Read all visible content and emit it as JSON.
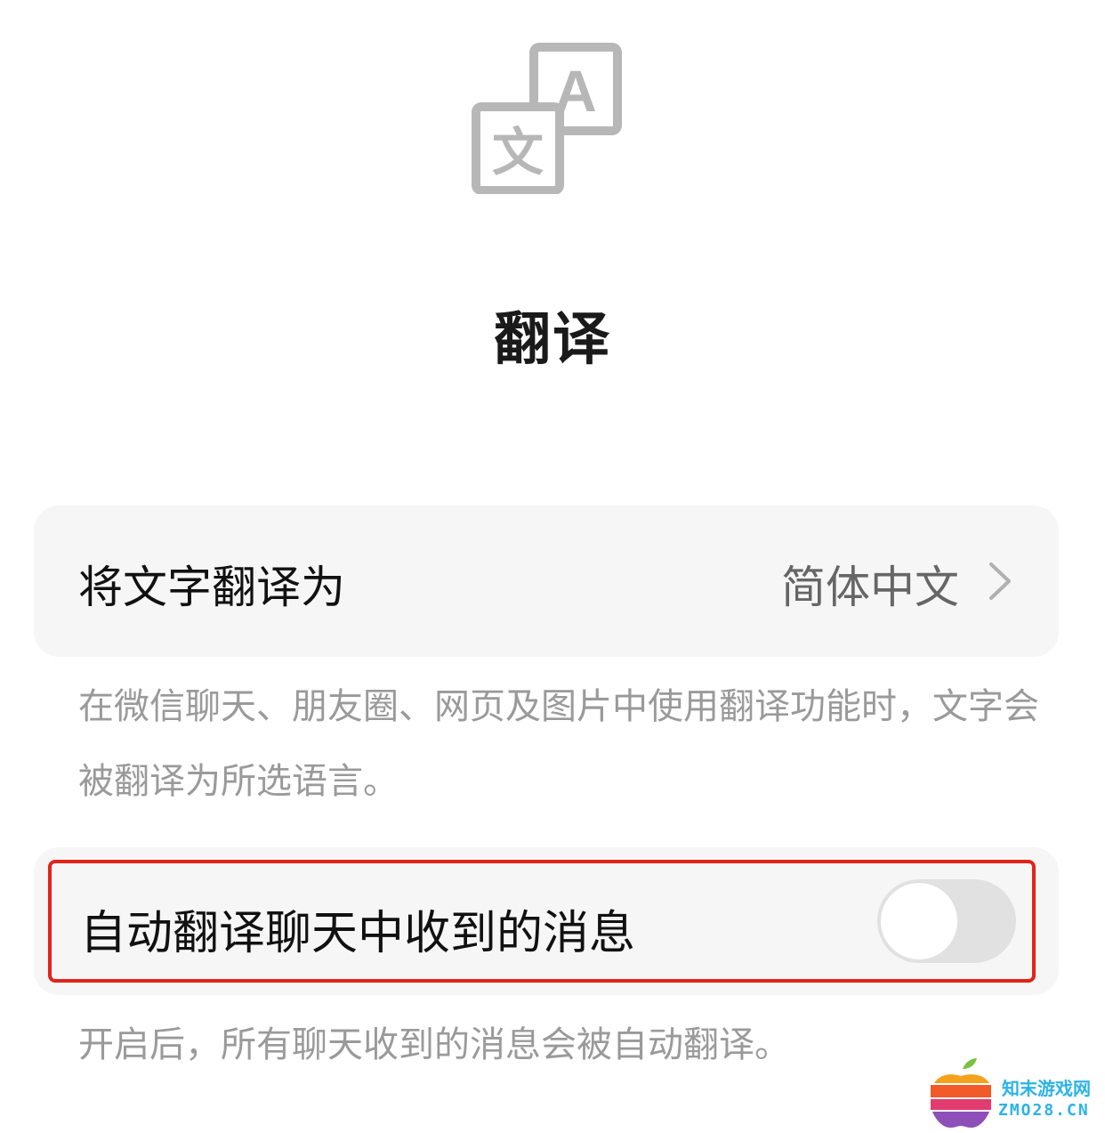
{
  "header": {
    "icon": "translate-icon",
    "title": "翻译"
  },
  "language_setting": {
    "label": "将文字翻译为",
    "value": "简体中文",
    "chevron_icon": "chevron-right-icon"
  },
  "language_description": "在微信聊天、朋友圈、网页及图片中使用翻译功能时，文字会被翻译为所选语言。",
  "auto_translate": {
    "label": "自动翻译聊天中收到的消息",
    "enabled": false
  },
  "auto_description": "开启后，所有聊天收到的消息会被自动翻译。",
  "watermark": {
    "name": "知末游戏网",
    "domain": "ZMO28.CN"
  },
  "colors": {
    "highlight_border": "#e2231a",
    "toggle_off": "#e1e1e1",
    "card_bg": "#f6f6f6",
    "watermark_text": "#2bb3e8"
  }
}
